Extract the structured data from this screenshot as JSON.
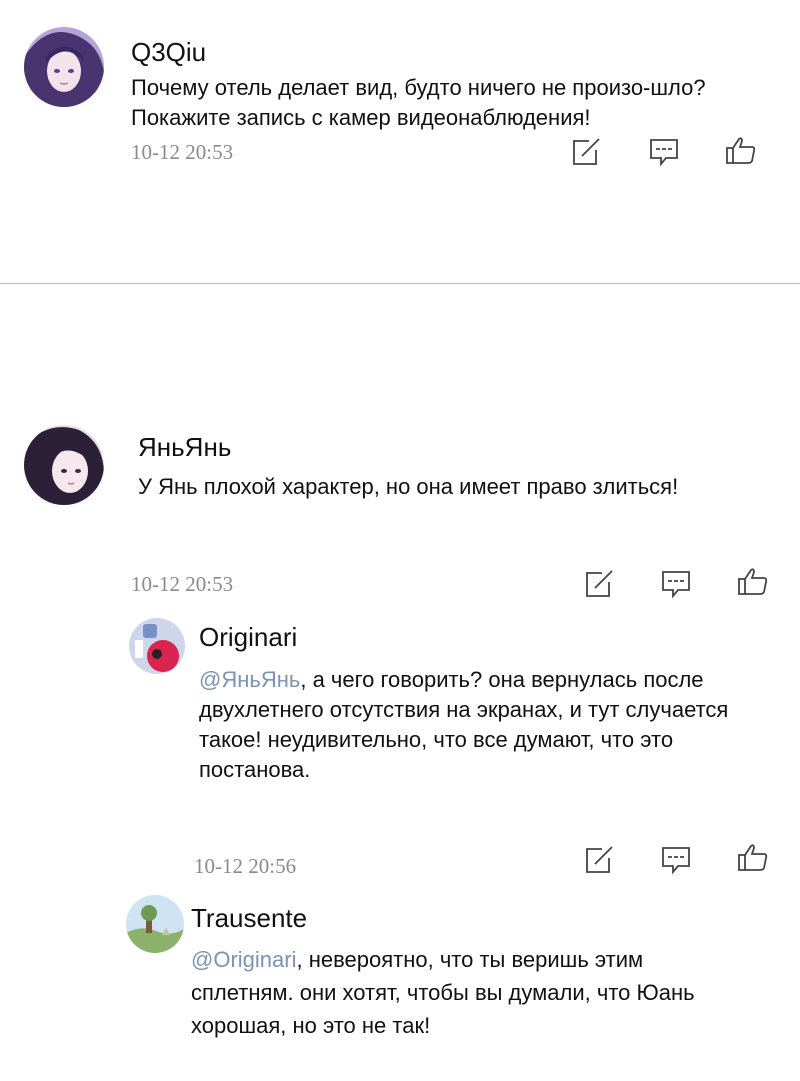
{
  "comments": [
    {
      "username": "Q3Qiu",
      "text": "Почему отель делает вид, будто ничего не произо-шло? Покажите запись с камер видеонаблюдения!",
      "time": "10-12  20:53",
      "avatar_icon": "anime-girl-avatar-purple"
    },
    {
      "username": "ЯньЯнь",
      "text": "У Янь плохой характер, но она имеет право злиться!",
      "time": "10-12  20:53",
      "avatar_icon": "anime-girl-avatar-dark"
    },
    {
      "username": "Originari",
      "mention": "@ЯньЯнь",
      "text": ", а чего говорить? она вернулась после двухлетнего отсутствия на экранах, и тут случается такое! неудивительно, что все думают, что это постанова.",
      "time": "10-12  20:56",
      "avatar_icon": "cartoon-avatar-pink"
    },
    {
      "username": "Trausente",
      "mention": "@Originari",
      "text": ", невероятно, что ты веришь этим сплетням. они хотят, чтобы вы думали, что Юань хорошая, но это не так!",
      "avatar_icon": "landscape-avatar"
    }
  ],
  "actions": {
    "edit_icon": "edit-icon",
    "reply_icon": "comment-icon",
    "like_icon": "thumbs-up-icon"
  },
  "colors": {
    "mention": "#7b93b3",
    "timestamp": "#8a8a8a",
    "divider": "#b8b8b8"
  }
}
